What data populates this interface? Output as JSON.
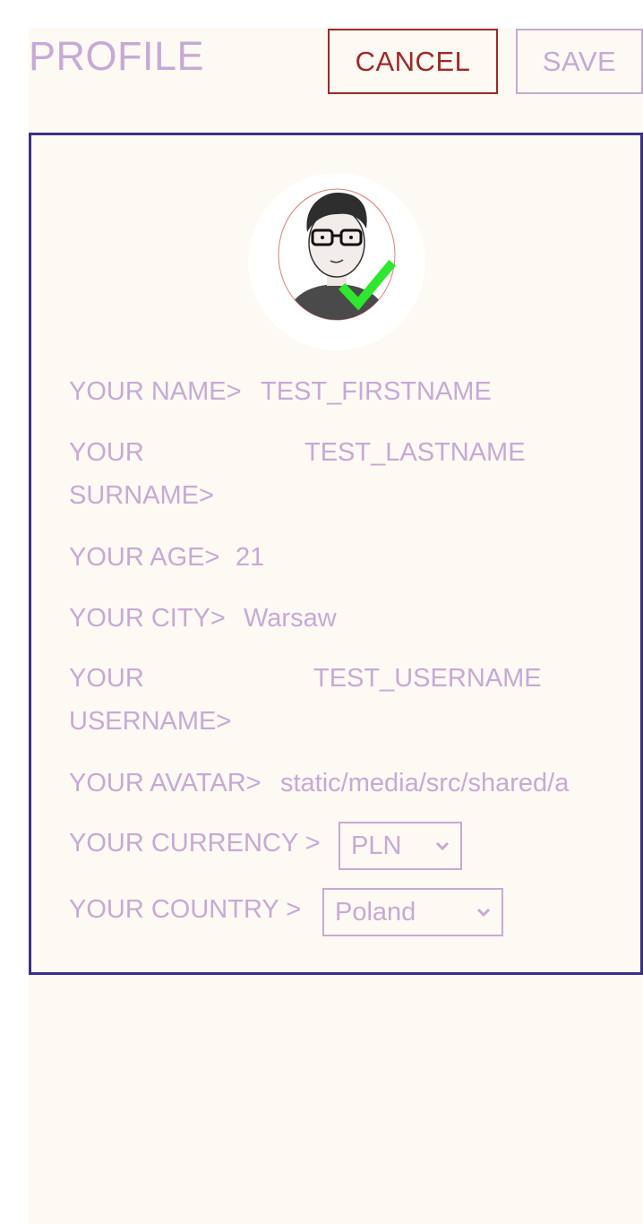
{
  "header": {
    "title": "PROFILE",
    "cancel_label": "CANCEL",
    "save_label": "SAVE"
  },
  "profile": {
    "name_label": "YOUR NAME>",
    "name_value": "TEST_FIRSTNAME",
    "surname_label": "YOUR SURNAME>",
    "surname_value": "TEST_LASTNAME",
    "age_label": "YOUR AGE>",
    "age_value": "21",
    "city_label": "YOUR CITY>",
    "city_value": "Warsaw",
    "username_label": "YOUR USERNAME>",
    "username_value": "TEST_USERNAME",
    "avatar_label": "YOUR AVATAR>",
    "avatar_value": "static/media/src/shared/a",
    "currency_label": "YOUR CURRENCY >",
    "currency_selected": "PLN",
    "country_label": "YOUR COUNTRY >",
    "country_selected": "Poland"
  },
  "icons": {
    "avatar": "avatar-illustration",
    "verified": "checkmark-icon",
    "dropdown": "chevron-down-icon"
  },
  "colors": {
    "accent": "#c7a9d6",
    "cancel": "#a32828",
    "card_border": "#3a2f8a",
    "background": "#fdf9f3",
    "check": "#2ee82e"
  }
}
